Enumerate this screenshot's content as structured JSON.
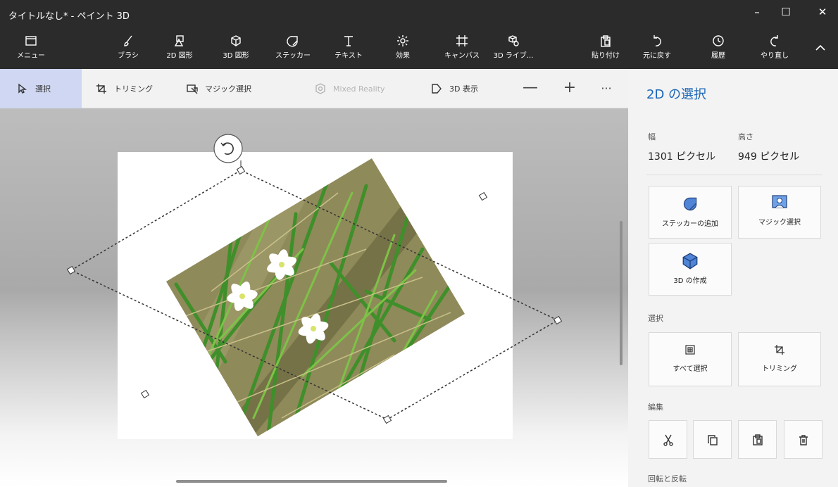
{
  "window": {
    "title": "タイトルなし* - ペイント 3D"
  },
  "ribbon": {
    "menu": "メニュー",
    "brush": "ブラシ",
    "shapes2d": "2D 図形",
    "shapes3d": "3D 図形",
    "sticker": "ステッカー",
    "text": "テキスト",
    "effects": "効果",
    "canvas": "キャンバス",
    "library3d": "3D ライブ...",
    "paste": "貼り付け",
    "undo": "元に戻す",
    "history": "履歴",
    "redo": "やり直し"
  },
  "toolbar": {
    "select": "選択",
    "crop": "トリミング",
    "magic_select": "マジック選択",
    "mixed_reality": "Mixed Reality",
    "view3d": "3D 表示",
    "zoom_out": "—",
    "zoom_in": "+",
    "more": "···"
  },
  "panel": {
    "title": "2D の選択",
    "width_label": "幅",
    "height_label": "高さ",
    "width_value": "1301 ピクセル",
    "height_value": "949 ピクセル",
    "add_sticker": "ステッカーの追加",
    "magic_select": "マジック選択",
    "make_3d": "3D の作成",
    "selection_section": "選択",
    "select_all": "すべて選択",
    "crop": "トリミング",
    "edit_section": "編集",
    "rotate_section": "回転と反転"
  },
  "colors": {
    "accent": "#1a66b8",
    "titlebar": "#2b2b2b",
    "selected_tool": "#cfd7f2"
  }
}
